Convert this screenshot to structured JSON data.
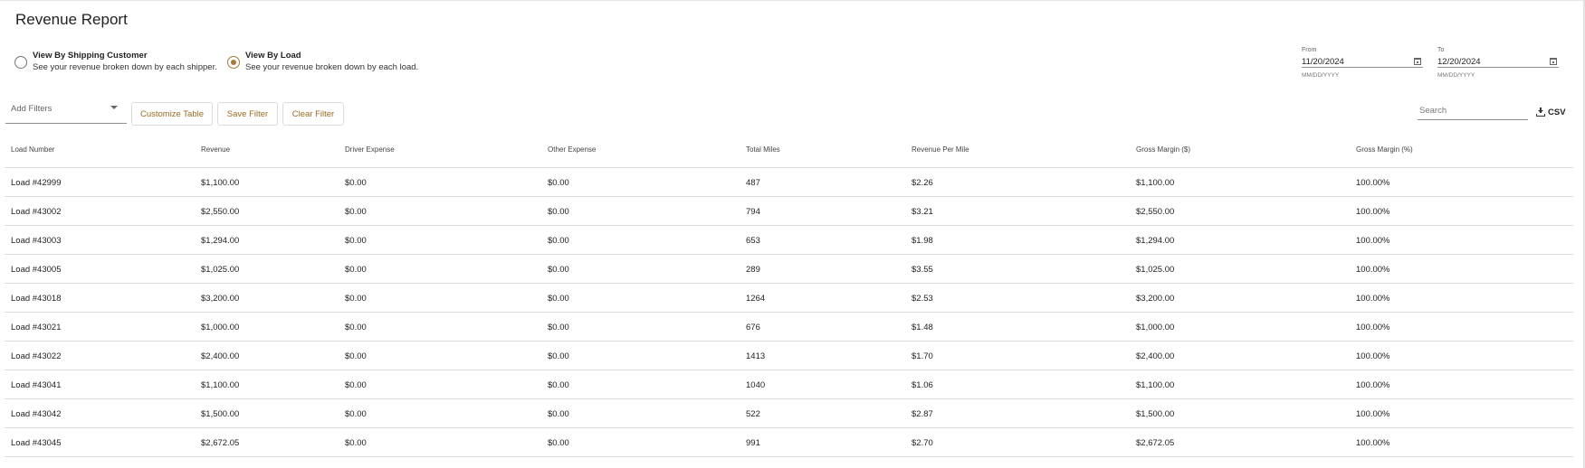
{
  "page": {
    "title": "Revenue Report"
  },
  "view_options": [
    {
      "title": "View By Shipping Customer",
      "description": "See your revenue broken down by each shipper.",
      "checked": false
    },
    {
      "title": "View By Load",
      "description": "See your revenue broken down by each load.",
      "checked": true
    }
  ],
  "date_range": {
    "from": {
      "label": "From",
      "value": "11/20/2024",
      "hint": "MM/DD/YYYY"
    },
    "to": {
      "label": "To",
      "value": "12/20/2024",
      "hint": "MM/DD/YYYY"
    }
  },
  "toolbar": {
    "filter_placeholder": "Add Filters",
    "customize_label": "Customize Table",
    "save_filter_label": "Save Filter",
    "clear_filter_label": "Clear Filter",
    "search_placeholder": "Search",
    "csv_label": "CSV"
  },
  "colors": {
    "accent": "#a57c3b",
    "button_text": "#9a6b22",
    "divider": "#dcdcdc"
  },
  "icons": {
    "csv": "download-icon",
    "date": "calendar-icon",
    "filter": "chevron-down-icon"
  },
  "table": {
    "columns": [
      "Load Number",
      "Revenue",
      "Driver Expense",
      "Other Expense",
      "Total Miles",
      "Revenue Per Mile",
      "Gross Margin ($)",
      "Gross Margin (%)"
    ],
    "rows": [
      [
        "Load #42999",
        "$1,100.00",
        "$0.00",
        "$0.00",
        "487",
        "$2.26",
        "$1,100.00",
        "100.00%"
      ],
      [
        "Load #43002",
        "$2,550.00",
        "$0.00",
        "$0.00",
        "794",
        "$3.21",
        "$2,550.00",
        "100.00%"
      ],
      [
        "Load #43003",
        "$1,294.00",
        "$0.00",
        "$0.00",
        "653",
        "$1.98",
        "$1,294.00",
        "100.00%"
      ],
      [
        "Load #43005",
        "$1,025.00",
        "$0.00",
        "$0.00",
        "289",
        "$3.55",
        "$1,025.00",
        "100.00%"
      ],
      [
        "Load #43018",
        "$3,200.00",
        "$0.00",
        "$0.00",
        "1264",
        "$2.53",
        "$3,200.00",
        "100.00%"
      ],
      [
        "Load #43021",
        "$1,000.00",
        "$0.00",
        "$0.00",
        "676",
        "$1.48",
        "$1,000.00",
        "100.00%"
      ],
      [
        "Load #43022",
        "$2,400.00",
        "$0.00",
        "$0.00",
        "1413",
        "$1.70",
        "$2,400.00",
        "100.00%"
      ],
      [
        "Load #43041",
        "$1,100.00",
        "$0.00",
        "$0.00",
        "1040",
        "$1.06",
        "$1,100.00",
        "100.00%"
      ],
      [
        "Load #43042",
        "$1,500.00",
        "$0.00",
        "$0.00",
        "522",
        "$2.87",
        "$1,500.00",
        "100.00%"
      ],
      [
        "Load #43045",
        "$2,672.05",
        "$0.00",
        "$0.00",
        "991",
        "$2.70",
        "$2,672.05",
        "100.00%"
      ]
    ]
  }
}
